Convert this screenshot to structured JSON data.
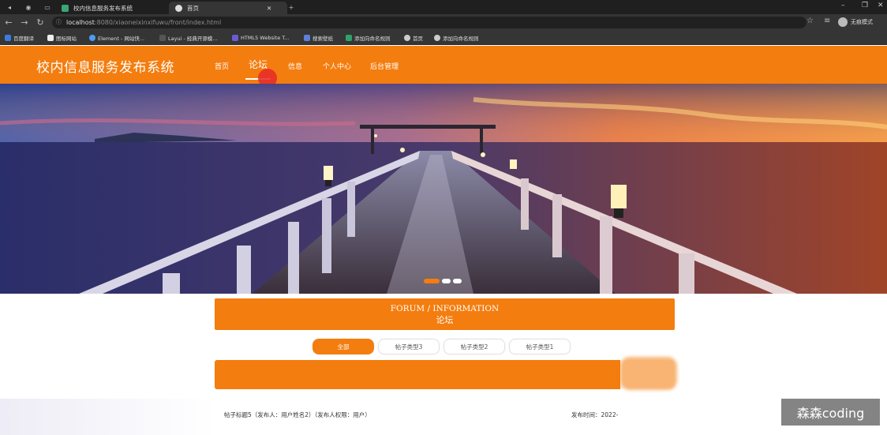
{
  "browser": {
    "tabs": [
      {
        "label": "校内信息服务发布系统",
        "active": false
      },
      {
        "label": "首页",
        "active": true
      }
    ],
    "new_tab": "+",
    "window_controls": {
      "minimize": "–",
      "maximize": "❐",
      "close": "✕"
    },
    "url_host": "localhost",
    "url_path": ":8080/xiaoneixinxifuwu/front/index.html",
    "profile_label": "无痕模式",
    "bookmarks": [
      "百度翻译",
      "图标网站",
      "Element - 网站快...",
      "Layui - 经典开源模...",
      "HTML5 Website T...",
      "搜索壁纸",
      "添加向命名规则",
      "首页",
      "添加向命名规则"
    ]
  },
  "site": {
    "title": "校内信息服务发布系统",
    "nav": [
      "首页",
      "论坛",
      "信息",
      "个人中心",
      "后台管理"
    ],
    "current_nav": "论坛"
  },
  "banner": {
    "slide_count": 3,
    "active_slide": 1
  },
  "forum": {
    "heading_en": "FORUM / INFORMATION",
    "heading_cn": "论坛",
    "filters": [
      "全部",
      "帖子类型3",
      "帖子类型2",
      "帖子类型1"
    ],
    "active_filter": "全部",
    "post": {
      "title": "帖子标题5（发布人：用户姓名2）（发布人权限：用户）",
      "time": "发布时间：2022-"
    }
  },
  "watermark": "森森coding",
  "colors": {
    "accent": "#f47d0f",
    "chrome_dark": "#1f1f1f",
    "chrome": "#353535"
  }
}
